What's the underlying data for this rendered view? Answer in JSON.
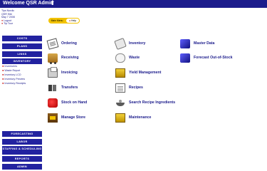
{
  "header": {
    "title": "Welcome QSR Admin"
  },
  "user": {
    "lines": [
      "Tips Nordic",
      "QSR Site",
      "May 7 2008"
    ],
    "links": [
      "Logout",
      "Tip Tour"
    ]
  },
  "sidebar": {
    "nav_top": [
      "COSTS",
      "PLANS",
      "LINKS",
      "INVENTORY"
    ],
    "sub_items": [
      "Inventories",
      "Waste Report",
      "Inventory LCO",
      "Inventory Preview",
      "Inventory Receipts"
    ],
    "nav_bottom": [
      "FORECASTING",
      "LABOR",
      "STAFFING & SCHEDULING",
      "REPORTS",
      "ADMIN"
    ]
  },
  "toolbar": {
    "main_menu_label": "Main Menu",
    "help_label": "Help"
  },
  "menu": {
    "col1": [
      {
        "label": "Ordering",
        "icon": "clipboard-icon"
      },
      {
        "label": "Receiving",
        "icon": "truck-icon"
      },
      {
        "label": "Invoicing",
        "icon": "printer-icon"
      },
      {
        "label": "Transfers",
        "icon": "transfer-icon"
      },
      {
        "label": "Stock on Hand",
        "icon": "stock-icon"
      },
      {
        "label": "Manage Store",
        "icon": "store-box-icon"
      }
    ],
    "col2": [
      {
        "label": "Inventory",
        "icon": "inventory-icon"
      },
      {
        "label": "Waste",
        "icon": "waste-icon"
      },
      {
        "label": "Yield Management",
        "icon": "yield-icon"
      },
      {
        "label": "Recipes",
        "icon": "recipe-icon"
      },
      {
        "label": "Search Recipe Ingredients",
        "icon": "search-recipe-icon"
      },
      {
        "label": "Maintenance",
        "icon": "maintenance-icon"
      }
    ],
    "col3": [
      {
        "label": "Master Data",
        "icon": "master-data-icon"
      },
      {
        "label": "Forecast Out-of-Stock",
        "icon": "forecast-icon"
      }
    ]
  },
  "colors": {
    "nav_blue": "#2222a0",
    "header_blue": "#1c1c8c",
    "accent_yellow": "#f2c200",
    "bullet_red": "#c00000"
  }
}
